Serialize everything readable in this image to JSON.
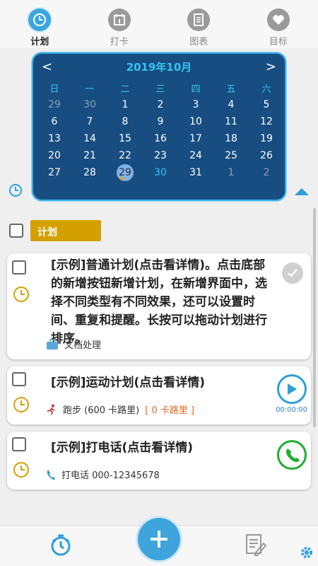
{
  "tabs": [
    {
      "label": "计划",
      "icon": "clock-icon",
      "active": true
    },
    {
      "label": "打卡",
      "icon": "calendar-icon",
      "active": false
    },
    {
      "label": "图表",
      "icon": "document-icon",
      "active": false
    },
    {
      "label": "目标",
      "icon": "heart-icon",
      "active": false
    }
  ],
  "calendar": {
    "title": "2019年10月",
    "prev": "<",
    "next": ">",
    "weekdays": [
      "日",
      "一",
      "二",
      "三",
      "四",
      "五",
      "六"
    ],
    "days": [
      {
        "d": "29",
        "o": true
      },
      {
        "d": "30",
        "o": true
      },
      {
        "d": "1"
      },
      {
        "d": "2"
      },
      {
        "d": "3"
      },
      {
        "d": "4"
      },
      {
        "d": "5"
      },
      {
        "d": "6"
      },
      {
        "d": "7"
      },
      {
        "d": "8"
      },
      {
        "d": "9"
      },
      {
        "d": "10"
      },
      {
        "d": "11"
      },
      {
        "d": "12"
      },
      {
        "d": "13"
      },
      {
        "d": "14"
      },
      {
        "d": "15"
      },
      {
        "d": "16"
      },
      {
        "d": "17"
      },
      {
        "d": "18"
      },
      {
        "d": "19"
      },
      {
        "d": "20"
      },
      {
        "d": "21"
      },
      {
        "d": "22"
      },
      {
        "d": "23"
      },
      {
        "d": "24"
      },
      {
        "d": "25"
      },
      {
        "d": "26"
      },
      {
        "d": "27"
      },
      {
        "d": "28"
      },
      {
        "d": "29",
        "today": true
      },
      {
        "d": "30",
        "sel": true
      },
      {
        "d": "31"
      },
      {
        "d": "1",
        "o": true
      },
      {
        "d": "2",
        "o": true
      }
    ]
  },
  "section": {
    "label": "计划"
  },
  "cards": [
    {
      "title": "[示例]普通计划(点击看详情)。点击底部的新增按钮新增计划，在新增界面中，选择不同类型有不同效果，还可以设置时间、重复和提醒。长按可以拖动计划进行排序。",
      "sub": "文档处理"
    },
    {
      "title": "[示例]运动计划(点击看详情)",
      "sub": "跑步 (600 卡路里)",
      "extra": "[ 0 卡路里 ]",
      "timer": "00:00:00"
    },
    {
      "title": "[示例]打电话(点击看详情)",
      "sub": "打电话 000-12345678"
    }
  ],
  "colors": {
    "accent": "#3aa6dd",
    "calendar_bg": "#174d80",
    "section": "#d4a000",
    "call": "#1fae2f"
  }
}
